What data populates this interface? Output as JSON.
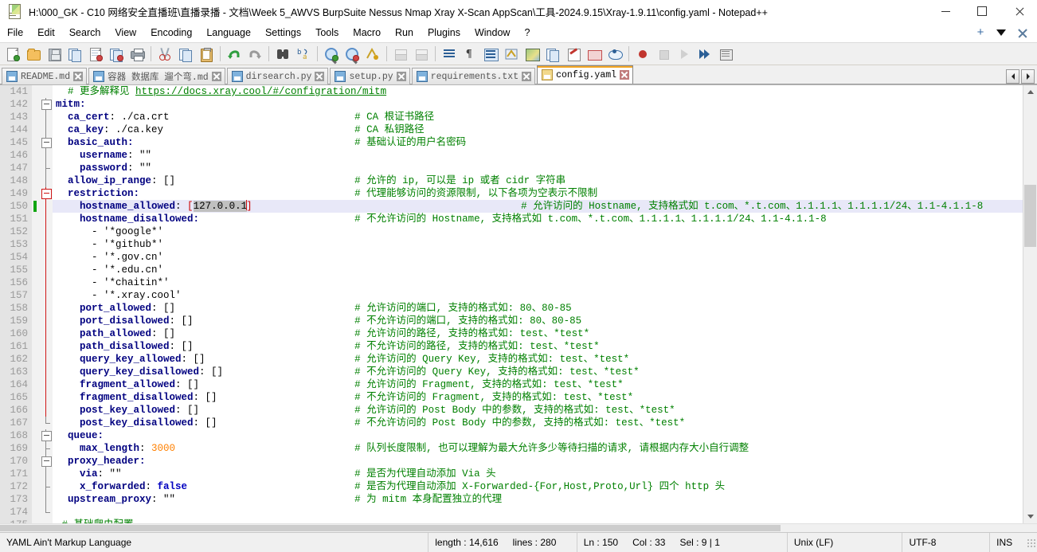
{
  "window": {
    "title": "H:\\000_GK - C10 网络安全直播班\\直播录播 - 文档\\Week 5_AWVS  BurpSuite  Nessus  Nmap  Xray  X-Scan  AppScan\\工具-2024.9.15\\Xray-1.9.11\\config.yaml - Notepad++",
    "app_icon": "notepad-plus-plus-icon",
    "minimize_label": "Minimize",
    "maximize_label": "Maximize",
    "close_label": "Close"
  },
  "menu": {
    "items": [
      "File",
      "Edit",
      "Search",
      "View",
      "Encoding",
      "Language",
      "Settings",
      "Tools",
      "Macro",
      "Run",
      "Plugins",
      "Window",
      "?"
    ],
    "right_controls": [
      "plus-icon",
      "chevron-down-icon",
      "close-icon"
    ]
  },
  "toolbar": {
    "groups": [
      [
        "new-file-icon",
        "open-file-icon",
        "save-icon",
        "save-all-icon",
        "close-file-icon",
        "close-all-files-icon",
        "print-icon"
      ],
      [
        "cut-icon",
        "copy-icon",
        "paste-icon"
      ],
      [
        "undo-icon",
        "redo-icon"
      ],
      [
        "find-icon",
        "replace-icon"
      ],
      [
        "zoom-in-icon",
        "zoom-out-icon",
        "sync-scroll-icon"
      ],
      [
        "word-wrap-off-icon",
        "word-wrap-on-icon"
      ],
      [
        "show-all-characters-icon",
        "pilcrow-icon",
        "indent-guide-icon",
        "uppercase-icon",
        "document-map-icon",
        "function-list-icon",
        "document-switcher-icon",
        "folder-as-workspace-icon",
        "monitoring-icon"
      ],
      [
        "record-macro-icon",
        "stop-recording-icon",
        "playback-macro-icon",
        "run-macro-multiple-icon",
        "save-macro-icon"
      ]
    ]
  },
  "tabs": {
    "items": [
      {
        "label": "README.md",
        "active": false
      },
      {
        "label": "容器 数据库 遛个弯.md",
        "active": false
      },
      {
        "label": "dirsearch.py",
        "active": false
      },
      {
        "label": "setup.py",
        "active": false
      },
      {
        "label": "requirements.txt",
        "active": false
      },
      {
        "label": "config.yaml",
        "active": true
      }
    ],
    "scroll_left_label": "◀",
    "scroll_right_label": "▶"
  },
  "editor": {
    "first_visible_line": 141,
    "current_line": 150,
    "lines": [
      {
        "n": 141,
        "fold": "none",
        "segs": [
          {
            "t": "  # 更多解释见 ",
            "c": "cm"
          },
          {
            "t": "https://docs.xray.cool/#/configration/mitm",
            "c": "url"
          }
        ]
      },
      {
        "n": 142,
        "fold": "open",
        "segs": [
          {
            "t": "mitm:",
            "c": "k"
          }
        ]
      },
      {
        "n": 143,
        "fold": "line",
        "segs": [
          {
            "t": "  ca_cert",
            "c": "k"
          },
          {
            "t": ": ./ca.crt",
            "c": "v"
          }
        ],
        "comment": "# CA 根证书路径"
      },
      {
        "n": 144,
        "fold": "line",
        "segs": [
          {
            "t": "  ca_key",
            "c": "k"
          },
          {
            "t": ": ./ca.key",
            "c": "v"
          }
        ],
        "comment": "# CA 私钥路径"
      },
      {
        "n": 145,
        "fold": "open",
        "segs": [
          {
            "t": "  basic_auth:",
            "c": "k"
          }
        ],
        "comment": "# 基础认证的用户名密码"
      },
      {
        "n": 146,
        "fold": "line",
        "segs": [
          {
            "t": "    username",
            "c": "k"
          },
          {
            "t": ": \"\"",
            "c": "v"
          }
        ]
      },
      {
        "n": 147,
        "fold": "tick",
        "segs": [
          {
            "t": "    password",
            "c": "k"
          },
          {
            "t": ": \"\"",
            "c": "v"
          }
        ]
      },
      {
        "n": 148,
        "fold": "line",
        "segs": [
          {
            "t": "  allow_ip_range",
            "c": "k"
          },
          {
            "t": ": []",
            "c": "v"
          }
        ],
        "comment": "# 允许的 ip, 可以是 ip 或者 cidr 字符串"
      },
      {
        "n": 149,
        "fold": "open-red",
        "segs": [
          {
            "t": "  restriction:",
            "c": "k"
          }
        ],
        "comment": "# 代理能够访问的资源限制, 以下各项为空表示不限制"
      },
      {
        "n": 150,
        "fold": "line-red",
        "bookmark": true,
        "highlight": true,
        "segs": [
          {
            "t": "    hostname_allowed",
            "c": "k"
          },
          {
            "t": ": ",
            "c": "v"
          },
          {
            "t": "[",
            "c": "brk"
          },
          {
            "t": "127.0.0.1",
            "c": "sel"
          },
          {
            "t": "]",
            "c": "brk"
          }
        ],
        "comment": "# 允许访问的 Hostname, 支持格式如 t.com、*.t.com、1.1.1.1、1.1.1.1/24、1.1-4.1.1-8",
        "comment_indent": 28
      },
      {
        "n": 151,
        "fold": "line-red",
        "segs": [
          {
            "t": "    hostname_disallowed:",
            "c": "k"
          }
        ],
        "comment": "# 不允许访问的 Hostname, 支持格式如 t.com、*.t.com、1.1.1.1、1.1.1.1/24、1.1-4.1.1-8"
      },
      {
        "n": 152,
        "fold": "line-red",
        "segs": [
          {
            "t": "      - '*google*'",
            "c": "v"
          }
        ]
      },
      {
        "n": 153,
        "fold": "line-red",
        "segs": [
          {
            "t": "      - '*github*'",
            "c": "v"
          }
        ]
      },
      {
        "n": 154,
        "fold": "line-red",
        "segs": [
          {
            "t": "      - '*.gov.cn'",
            "c": "v"
          }
        ]
      },
      {
        "n": 155,
        "fold": "line-red",
        "segs": [
          {
            "t": "      - '*.edu.cn'",
            "c": "v"
          }
        ]
      },
      {
        "n": 156,
        "fold": "line-red",
        "segs": [
          {
            "t": "      - '*chaitin*'",
            "c": "v"
          }
        ]
      },
      {
        "n": 157,
        "fold": "line-red",
        "segs": [
          {
            "t": "      - '*.xray.cool'",
            "c": "v"
          }
        ]
      },
      {
        "n": 158,
        "fold": "line-red",
        "segs": [
          {
            "t": "    port_allowed",
            "c": "k"
          },
          {
            "t": ": []",
            "c": "v"
          }
        ],
        "comment": "# 允许访问的端口, 支持的格式如: 80、80-85"
      },
      {
        "n": 159,
        "fold": "line-red",
        "segs": [
          {
            "t": "    port_disallowed",
            "c": "k"
          },
          {
            "t": ": []",
            "c": "v"
          }
        ],
        "comment": "# 不允许访问的端口, 支持的格式如: 80、80-85"
      },
      {
        "n": 160,
        "fold": "line-red",
        "segs": [
          {
            "t": "    path_allowed",
            "c": "k"
          },
          {
            "t": ": []",
            "c": "v"
          }
        ],
        "comment": "# 允许访问的路径, 支持的格式如: test、*test*"
      },
      {
        "n": 161,
        "fold": "line-red",
        "segs": [
          {
            "t": "    path_disallowed",
            "c": "k"
          },
          {
            "t": ": []",
            "c": "v"
          }
        ],
        "comment": "# 不允许访问的路径, 支持的格式如: test、*test*"
      },
      {
        "n": 162,
        "fold": "line-red",
        "segs": [
          {
            "t": "    query_key_allowed",
            "c": "k"
          },
          {
            "t": ": []",
            "c": "v"
          }
        ],
        "comment": "# 允许访问的 Query Key, 支持的格式如: test、*test*"
      },
      {
        "n": 163,
        "fold": "line-red",
        "segs": [
          {
            "t": "    query_key_disallowed",
            "c": "k"
          },
          {
            "t": ": []",
            "c": "v"
          }
        ],
        "comment": "# 不允许访问的 Query Key, 支持的格式如: test、*test*"
      },
      {
        "n": 164,
        "fold": "line-red",
        "segs": [
          {
            "t": "    fragment_allowed",
            "c": "k"
          },
          {
            "t": ": []",
            "c": "v"
          }
        ],
        "comment": "# 允许访问的 Fragment, 支持的格式如: test、*test*"
      },
      {
        "n": 165,
        "fold": "line-red",
        "segs": [
          {
            "t": "    fragment_disallowed",
            "c": "k"
          },
          {
            "t": ": []",
            "c": "v"
          }
        ],
        "comment": "# 不允许访问的 Fragment, 支持的格式如: test、*test*"
      },
      {
        "n": 166,
        "fold": "line-red",
        "segs": [
          {
            "t": "    post_key_allowed",
            "c": "k"
          },
          {
            "t": ": []",
            "c": "v"
          }
        ],
        "comment": "# 允许访问的 Post Body 中的参数, 支持的格式如: test、*test*"
      },
      {
        "n": 167,
        "fold": "end-red",
        "segs": [
          {
            "t": "    post_key_disallowed",
            "c": "k"
          },
          {
            "t": ": []",
            "c": "v"
          }
        ],
        "comment": "# 不允许访问的 Post Body 中的参数, 支持的格式如: test、*test*"
      },
      {
        "n": 168,
        "fold": "open",
        "segs": [
          {
            "t": "  queue:",
            "c": "k"
          }
        ]
      },
      {
        "n": 169,
        "fold": "tick",
        "segs": [
          {
            "t": "    max_length",
            "c": "k"
          },
          {
            "t": ": ",
            "c": "v"
          },
          {
            "t": "3000",
            "c": "num"
          }
        ],
        "comment": "# 队列长度限制, 也可以理解为最大允许多少等待扫描的请求, 请根据内存大小自行调整"
      },
      {
        "n": 170,
        "fold": "open",
        "segs": [
          {
            "t": "  proxy_header:",
            "c": "k"
          }
        ]
      },
      {
        "n": 171,
        "fold": "line",
        "segs": [
          {
            "t": "    via",
            "c": "k"
          },
          {
            "t": ": \"\"",
            "c": "v"
          }
        ],
        "comment": "# 是否为代理自动添加 Via 头"
      },
      {
        "n": 172,
        "fold": "tick",
        "segs": [
          {
            "t": "    x_forwarded",
            "c": "k"
          },
          {
            "t": ": ",
            "c": "v"
          },
          {
            "t": "false",
            "c": "bl"
          }
        ],
        "comment": "# 是否为代理自动添加 X-Forwarded-{For,Host,Proto,Url} 四个 http 头"
      },
      {
        "n": 173,
        "fold": "line",
        "segs": [
          {
            "t": "  upstream_proxy",
            "c": "k"
          },
          {
            "t": ": \"\"",
            "c": "v"
          }
        ],
        "comment": "# 为 mitm 本身配置独立的代理"
      },
      {
        "n": 174,
        "fold": "end",
        "segs": []
      },
      {
        "n": 175,
        "fold": "none",
        "segs": [
          {
            "t": " # 基础爬虫配置",
            "c": "cm"
          }
        ]
      }
    ]
  },
  "statusbar": {
    "doc_type": "YAML Ain't Markup Language",
    "length": "length : 14,616",
    "lines": "lines : 280",
    "ln": "Ln : 150",
    "col": "Col : 33",
    "sel": "Sel : 9 | 1",
    "eol": "Unix (LF)",
    "encoding": "UTF-8",
    "mode": "INS"
  },
  "colors": {
    "comment": "#008000",
    "key": "#000080",
    "number": "#ff8000",
    "selection": "#c0c0c0",
    "current_line": "#e8e8f8",
    "fold_active": "#d01616",
    "bookmark": "#11a511",
    "active_tab_accent": "#f5a623"
  }
}
